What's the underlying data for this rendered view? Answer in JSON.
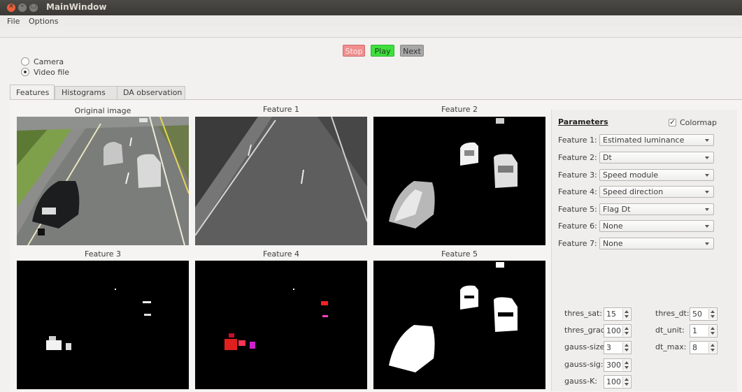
{
  "window": {
    "title": "MainWindow"
  },
  "menu": {
    "file": "File",
    "options": "Options"
  },
  "source": {
    "camera": "Camera",
    "video_file": "Video file",
    "selected": "video_file"
  },
  "controls": {
    "stop": "Stop",
    "play": "Play",
    "next": "Next"
  },
  "tabs": [
    "Features",
    "Histograms",
    "DA observation"
  ],
  "active_tab": "Features",
  "images": {
    "original": "Original image",
    "f1": "Feature 1",
    "f2": "Feature 2",
    "f3": "Feature 3",
    "f4": "Feature 4",
    "f5": "Feature 5"
  },
  "params": {
    "title": "Parameters",
    "colormap_label": "Colormap",
    "colormap_checked": true,
    "features": [
      {
        "label": "Feature 1:",
        "value": "Estimated luminance"
      },
      {
        "label": "Feature 2:",
        "value": "Dt"
      },
      {
        "label": "Feature 3:",
        "value": "Speed module"
      },
      {
        "label": "Feature 4:",
        "value": "Speed direction"
      },
      {
        "label": "Feature 5:",
        "value": "Flag Dt"
      },
      {
        "label": "Feature 6:",
        "value": "None"
      },
      {
        "label": "Feature 7:",
        "value": "None"
      }
    ],
    "thres_sat": {
      "label": "thres_sat:",
      "value": "15"
    },
    "thres_grad": {
      "label": "thres_grad:",
      "value": "100"
    },
    "gauss_size": {
      "label": "gauss-size:",
      "value": "3"
    },
    "gauss_sig": {
      "label": "gauss-sig:",
      "value": "300"
    },
    "gauss_k": {
      "label": "gauss-K:",
      "value": "100"
    },
    "thres_dt": {
      "label": "thres_dt:",
      "value": "50"
    },
    "dt_unit": {
      "label": "dt_unit:",
      "value": "1"
    },
    "dt_max": {
      "label": "dt_max:",
      "value": "8"
    }
  },
  "colors": {
    "stop": "#f08e8e",
    "play": "#3ddf3d",
    "next": "#a7a7a7",
    "close": "#e9603a"
  }
}
